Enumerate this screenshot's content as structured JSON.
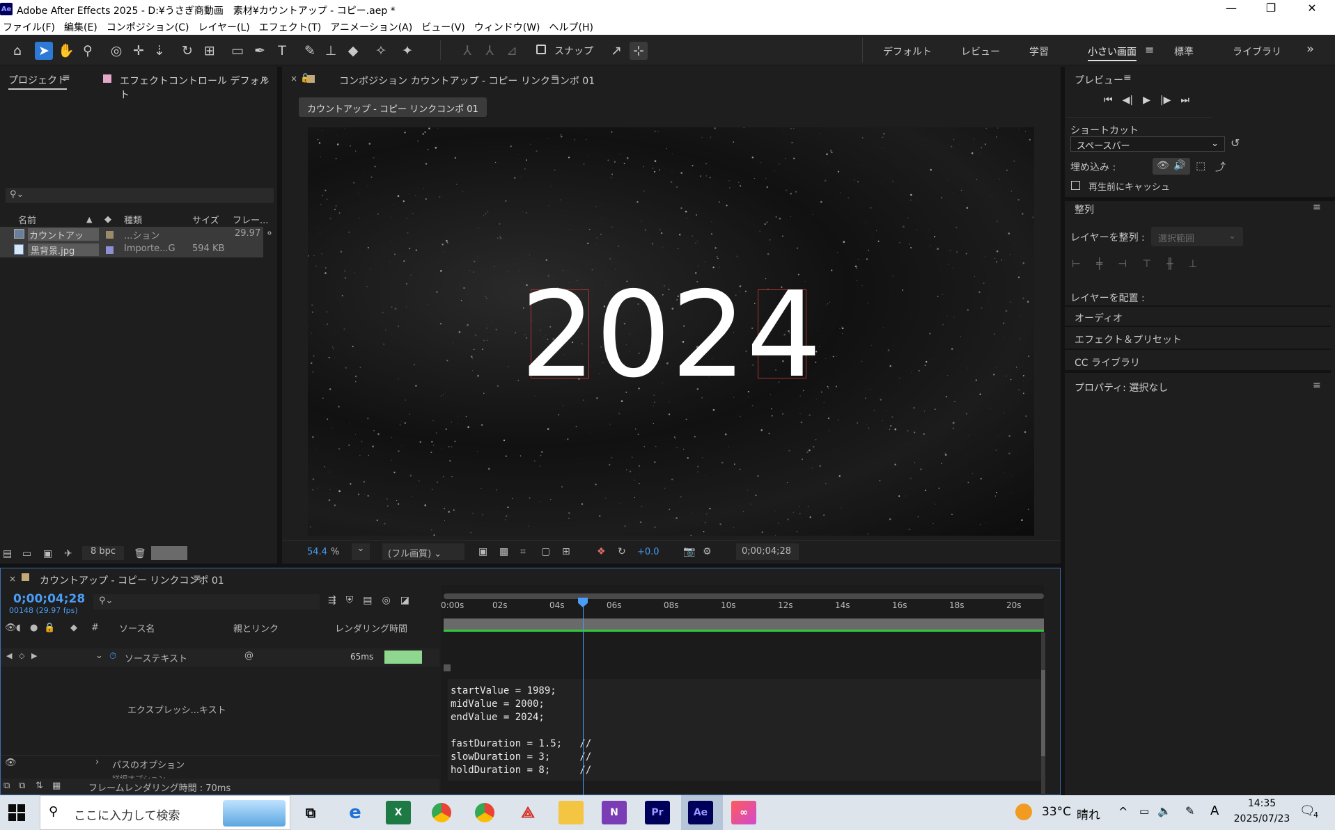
{
  "window": {
    "title": "Adobe After Effects 2025 - D:¥うさぎ商動画　素材¥カウントアップ - コピー.aep *",
    "app_icon_label": "Ae",
    "minimize": "—",
    "restore": "❐",
    "close": "✕"
  },
  "menu": [
    "ファイル(F)",
    "編集(E)",
    "コンポジション(C)",
    "レイヤー(L)",
    "エフェクト(T)",
    "アニメーション(A)",
    "ビュー(V)",
    "ウィンドウ(W)",
    "ヘルプ(H)"
  ],
  "toolbar": {
    "snap_label": "スナップ",
    "workspaces": [
      "デフォルト",
      "レビュー",
      "学習",
      "小さい画面",
      "標準",
      "ライブラリ"
    ],
    "active_workspace": "小さい画面",
    "more": "»"
  },
  "project": {
    "tab_project": "プロジェクト",
    "tab_effects": "エフェクトコントロール デフォルト",
    "search_placeholder": "",
    "columns": {
      "name": "名前",
      "type": "種類",
      "size": "サイズ",
      "frame": "フレー..."
    },
    "items": [
      {
        "name": "カウントアップ...",
        "type": "...ション",
        "size": "",
        "frame": "29.97",
        "color": "#9c8b6a"
      },
      {
        "name": "黒背景.jpg",
        "type": "Importe...G",
        "size": "594 KB",
        "frame": "",
        "color": "#8f8fd6"
      }
    ],
    "bpc": "8 bpc"
  },
  "comp": {
    "tab_title": "コンポジション カウントアップ - コピー リンクコンポ 01",
    "breadcrumb": "カウントアップ - コピー リンクコンポ 01",
    "display_text": "2024",
    "zoom": "54.4",
    "zoom_unit": "%",
    "quality": "(フル画質)",
    "exposure": "+0.0",
    "timecode": "0;00;04;28"
  },
  "preview": {
    "title": "プレビュー",
    "shortcut_label": "ショートカット",
    "shortcut_value": "スペースバー",
    "embed_label": "埋め込み :",
    "cache_label": "再生前にキャッシュ"
  },
  "align": {
    "title": "整列",
    "align_layers_label": "レイヤーを整列 :",
    "align_target": "選択範囲",
    "distribute_label": "レイヤーを配置 :"
  },
  "right_sections": [
    "オーディオ",
    "エフェクト＆プリセット",
    "CC ライブラリ"
  ],
  "properties_title": "プロパティ: 選択なし",
  "timeline": {
    "tab_title": "カウントアップ - コピー リンクコンポ 01",
    "current_time": "0;00;04;28",
    "frame_info": "00148 (29.97 fps)",
    "columns": {
      "num": "#",
      "source": "ソース名",
      "parent": "親とリンク",
      "render": "レンダリング時間"
    },
    "row_source_text": "ソーステキスト",
    "render_ms": "65ms",
    "expression_label": "エクスプレッシ...キスト",
    "path_options": "パスのオプション",
    "detail_options": "詳細オプション",
    "frame_render_time": "フレームレンダリング時間 : 70ms",
    "ruler": [
      "0:00s",
      "02s",
      "04s",
      "06s",
      "08s",
      "10s",
      "12s",
      "14s",
      "16s",
      "18s",
      "20s"
    ],
    "playhead_fraction": 0.25,
    "code_lines": [
      "startValue = 1989;",
      "midValue = 2000;",
      "endValue = 2024;",
      "",
      "fastDuration = 1.5;   //",
      "slowDuration = 3;     //",
      "holdDuration = 8;     //"
    ]
  },
  "taskbar": {
    "search_placeholder": "ここに入力して検索",
    "weather_temp": "33°C",
    "weather_text": "晴れ",
    "ime": "A",
    "time": "14:35",
    "date": "2025/07/23",
    "notif_count": "4",
    "apps": [
      "task-view",
      "internet-explorer",
      "excel",
      "chrome",
      "chrome-profile",
      "acrobat",
      "file-explorer",
      "onenote",
      "premiere-pro",
      "after-effects",
      "creative-cloud"
    ]
  }
}
